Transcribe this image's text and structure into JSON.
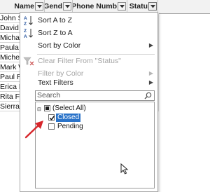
{
  "spreadsheet": {
    "headers": [
      {
        "key": "name",
        "label": "Name"
      },
      {
        "key": "gender",
        "label": "Gend"
      },
      {
        "key": "phone",
        "label": "Phone Numb"
      },
      {
        "key": "status",
        "label": "Statu"
      }
    ],
    "name_cells": [
      "John Sm",
      "David Jo",
      "Michael",
      "Paula Le",
      "Michelle",
      "Mark Wi",
      "Paul Roo",
      "Erica Fe",
      "Rita Fox",
      "Sierra V"
    ]
  },
  "filter_menu": {
    "items": [
      {
        "key": "sort_az",
        "label": "Sort A to Z",
        "icon": "sort-ascending-icon",
        "enabled": true,
        "submenu": false
      },
      {
        "key": "sort_za",
        "label": "Sort Z to A",
        "icon": "sort-descending-icon",
        "enabled": true,
        "submenu": false
      },
      {
        "key": "sort_color",
        "label": "Sort by Color",
        "icon": "",
        "enabled": true,
        "submenu": true
      },
      {
        "key": "clear_filter",
        "label": "Clear Filter From \"Status\"",
        "icon": "clear-filter-icon",
        "enabled": false,
        "submenu": false
      },
      {
        "key": "filter_color",
        "label": "Filter by Color",
        "icon": "",
        "enabled": false,
        "submenu": true
      },
      {
        "key": "text_filters",
        "label": "Text Filters",
        "icon": "",
        "enabled": true,
        "submenu": true
      }
    ],
    "search_placeholder": "Search",
    "values": [
      {
        "label": "(Select All)",
        "state": "mixed"
      },
      {
        "label": "Closed",
        "state": "checked",
        "highlighted": true
      },
      {
        "label": "Pending",
        "state": "unchecked"
      }
    ]
  },
  "colors": {
    "selection": "#2a73c9",
    "annotation_arrow": "#d7262b",
    "disabled_text": "#a4a4a4"
  }
}
